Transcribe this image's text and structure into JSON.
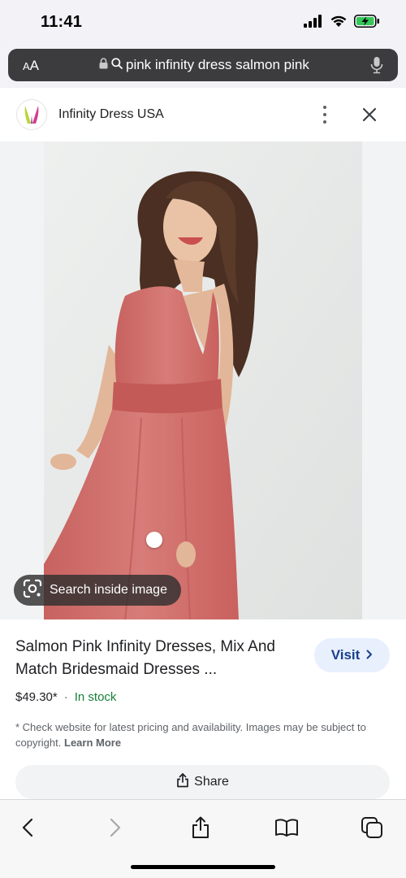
{
  "status_bar": {
    "time": "11:41",
    "icons": [
      "signal-icon",
      "wifi-icon",
      "battery-charging-icon"
    ],
    "battery_color": "#34c759"
  },
  "url_bar": {
    "text_size_label_big": "A",
    "text_size_label_small": "A",
    "query": "pink infinity dress salmon pink",
    "icons": [
      "lock-icon",
      "search-icon",
      "mic-icon"
    ]
  },
  "site": {
    "name": "Infinity Dress USA",
    "icons": [
      "site-logo-icon",
      "more-vert-icon",
      "close-icon"
    ]
  },
  "image": {
    "search_inside_label": "Search inside image",
    "dress_color": "#d0726f"
  },
  "result": {
    "title": "Salmon Pink Infinity Dresses, Mix And Match Bridesmaid Dresses ...",
    "visit_label": "Visit",
    "price": "$49.30*",
    "separator": "·",
    "stock": "In stock",
    "disclaimer": "* Check website for latest pricing and availability. Images may be subject to copyright.",
    "learn_more": "Learn More",
    "share_label": "Share"
  },
  "toolbar": {
    "icons": [
      "back-icon",
      "forward-icon",
      "share-icon",
      "bookmarks-icon",
      "tabs-icon"
    ]
  }
}
